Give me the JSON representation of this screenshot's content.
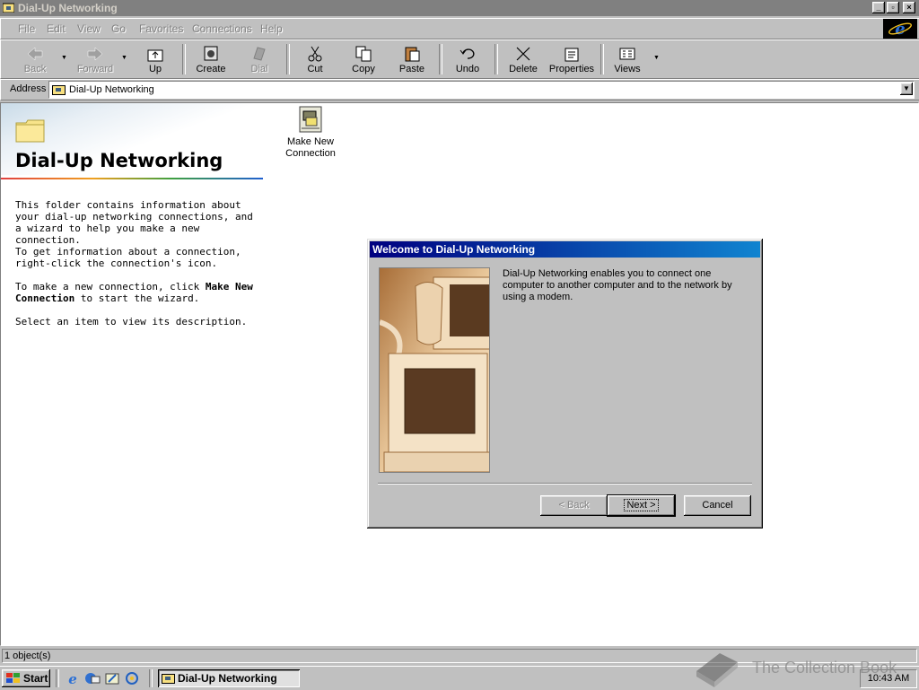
{
  "window": {
    "title": "Dial-Up Networking"
  },
  "menu": [
    "File",
    "Edit",
    "View",
    "Go",
    "Favorites",
    "Connections",
    "Help"
  ],
  "toolbar": {
    "back": "Back",
    "forward": "Forward",
    "up": "Up",
    "create": "Create",
    "dial": "Dial",
    "cut": "Cut",
    "copy": "Copy",
    "paste": "Paste",
    "undo": "Undo",
    "delete": "Delete",
    "properties": "Properties",
    "views": "Views"
  },
  "address": {
    "label": "Address",
    "value": "Dial-Up Networking"
  },
  "left_pane": {
    "title": "Dial-Up Networking",
    "p1": "This folder contains information about your dial-up networking connections, and a wizard to help you make a new connection.",
    "p2": "To get information about a connection, right-click the connection's icon.",
    "p3_prefix": "To make a new connection, click ",
    "p3_bold": "Make New Connection",
    "p3_suffix": " to start the wizard.",
    "p4": "Select an item to view its description."
  },
  "items": [
    {
      "label_line1": "Make New",
      "label_line2": "Connection"
    }
  ],
  "dialog": {
    "title": "Welcome to Dial-Up Networking",
    "text": "Dial-Up Networking enables you to connect one computer to another computer and to the network by using a modem.",
    "back": "< Back",
    "next": "Next >",
    "cancel": "Cancel"
  },
  "status": {
    "text": "1 object(s)"
  },
  "taskbar": {
    "start": "Start",
    "task": "Dial-Up Networking",
    "clock": "10:43 AM"
  },
  "watermark": "The Collection Book"
}
